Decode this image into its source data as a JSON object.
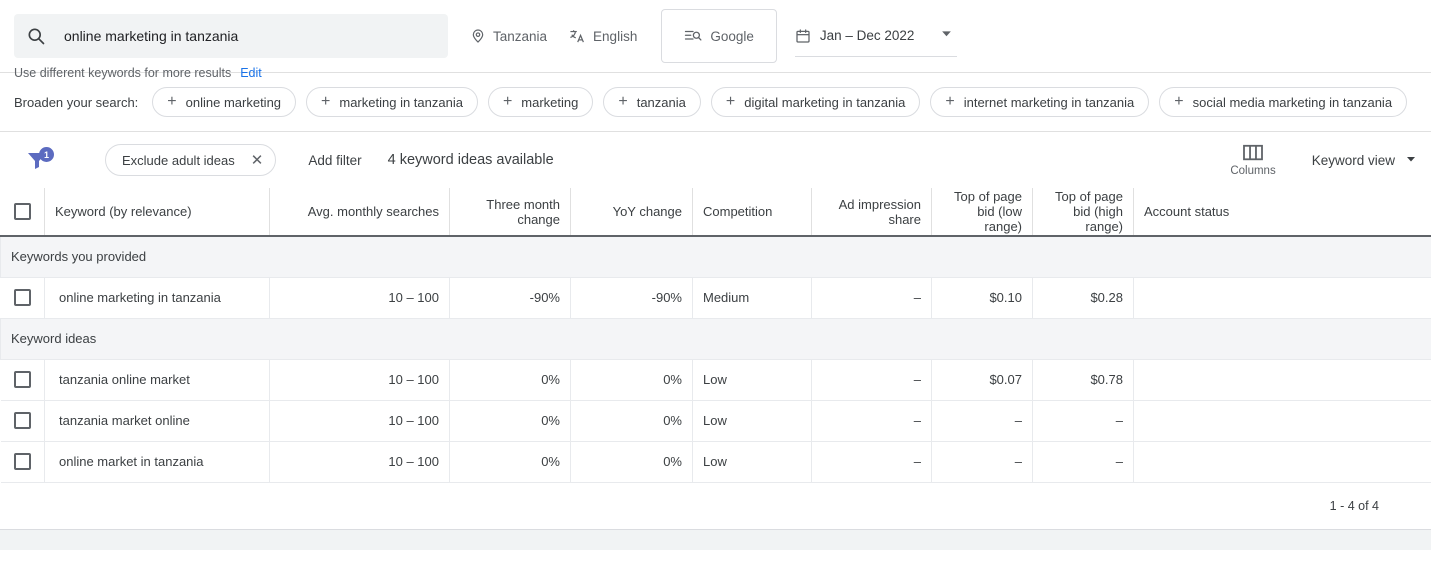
{
  "search": {
    "value": "online marketing in tanzania",
    "placeholder": "Enter a keyword",
    "hint": "Use different keywords for more results",
    "edit_label": "Edit"
  },
  "toolbar": {
    "location": "Tanzania",
    "language": "English",
    "network": "Google",
    "date_range": "Jan – Dec 2022"
  },
  "broaden": {
    "label": "Broaden your search:",
    "chips": [
      "online marketing",
      "marketing in tanzania",
      "marketing",
      "tanzania",
      "digital marketing in tanzania",
      "internet marketing in tanzania",
      "social media marketing in tanzania"
    ]
  },
  "filters": {
    "badge_count": "1",
    "active_filter": "Exclude adult ideas",
    "add_filter": "Add filter",
    "idea_count": "4 keyword ideas available",
    "columns_label": "Columns",
    "view_label": "Keyword view"
  },
  "table": {
    "columns": [
      "Keyword (by relevance)",
      "Avg. monthly searches",
      "Three month change",
      "YoY change",
      "Competition",
      "Ad impression share",
      "Top of page bid (low range)",
      "Top of page bid (high range)",
      "Account status"
    ],
    "sections": [
      {
        "title": "Keywords you provided",
        "rows": [
          {
            "keyword": "online marketing in tanzania",
            "avg_monthly_searches": "10 – 100",
            "three_month_change": "-90%",
            "yoy_change": "-90%",
            "competition": "Medium",
            "ad_impression_share": "–",
            "top_bid_low": "$0.10",
            "top_bid_high": "$0.28",
            "account_status": ""
          }
        ]
      },
      {
        "title": "Keyword ideas",
        "rows": [
          {
            "keyword": "tanzania online market",
            "avg_monthly_searches": "10 – 100",
            "three_month_change": "0%",
            "yoy_change": "0%",
            "competition": "Low",
            "ad_impression_share": "–",
            "top_bid_low": "$0.07",
            "top_bid_high": "$0.78",
            "account_status": ""
          },
          {
            "keyword": "tanzania market online",
            "avg_monthly_searches": "10 – 100",
            "three_month_change": "0%",
            "yoy_change": "0%",
            "competition": "Low",
            "ad_impression_share": "–",
            "top_bid_low": "–",
            "top_bid_high": "–",
            "account_status": ""
          },
          {
            "keyword": "online market in tanzania",
            "avg_monthly_searches": "10 – 100",
            "three_month_change": "0%",
            "yoy_change": "0%",
            "competition": "Low",
            "ad_impression_share": "–",
            "top_bid_low": "–",
            "top_bid_high": "–",
            "account_status": ""
          }
        ]
      }
    ]
  },
  "footer": {
    "pagination": "1 - 4 of 4"
  },
  "colors": {
    "filter_accent": "#5c6bc0",
    "link": "#1a73e8",
    "search_field_bg": "#f1f3f4",
    "section_bg": "#f4f5f7"
  }
}
